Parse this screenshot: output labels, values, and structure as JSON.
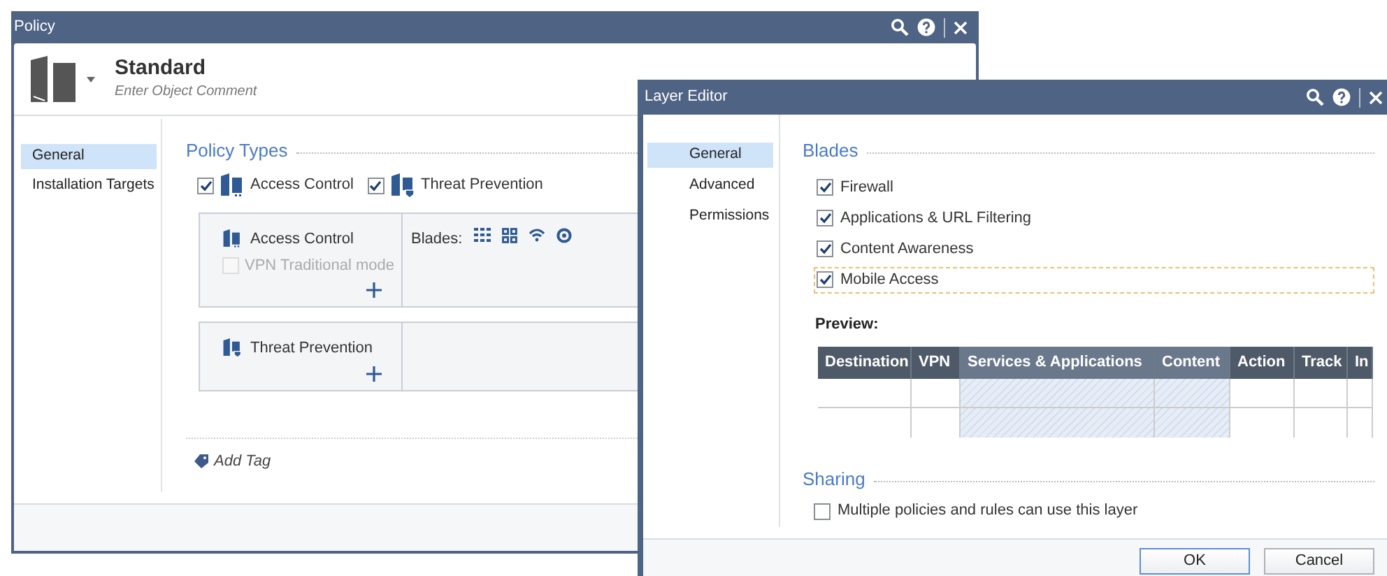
{
  "policy_window": {
    "title": "Policy",
    "header": {
      "name": "Standard",
      "comment": "Enter Object Comment"
    },
    "nav": [
      {
        "label": "General",
        "selected": true
      },
      {
        "label": "Installation Targets",
        "selected": false
      }
    ],
    "policy_types": {
      "title": "Policy Types",
      "options": [
        {
          "label": "Access Control",
          "checked": true
        },
        {
          "label": "Threat Prevention",
          "checked": true
        }
      ]
    },
    "cards": [
      {
        "title": "Access Control",
        "option": {
          "label": "VPN Traditional mode",
          "checked": false,
          "disabled": true
        },
        "blades_label": "Blades:"
      },
      {
        "title": "Threat Prevention"
      }
    ],
    "add_tag": "Add Tag"
  },
  "layer_editor": {
    "title": "Layer Editor",
    "nav": [
      {
        "label": "General",
        "selected": true
      },
      {
        "label": "Advanced",
        "selected": false
      },
      {
        "label": "Permissions",
        "selected": false
      }
    ],
    "blades": {
      "title": "Blades",
      "items": [
        {
          "label": "Firewall",
          "checked": true,
          "focused": false
        },
        {
          "label": "Applications & URL Filtering",
          "checked": true,
          "focused": false
        },
        {
          "label": "Content Awareness",
          "checked": true,
          "focused": false
        },
        {
          "label": "Mobile Access",
          "checked": true,
          "focused": true
        }
      ]
    },
    "preview": {
      "title": "Preview:",
      "columns": [
        {
          "label": "Destination",
          "highlighted": false
        },
        {
          "label": "VPN",
          "highlighted": false
        },
        {
          "label": "Services & Applications",
          "highlighted": true
        },
        {
          "label": "Content",
          "highlighted": true
        },
        {
          "label": "Action",
          "highlighted": false
        },
        {
          "label": "Track",
          "highlighted": false
        },
        {
          "label": "In",
          "highlighted": false
        }
      ]
    },
    "sharing": {
      "title": "Sharing",
      "option": {
        "label": "Multiple policies and rules can use this layer",
        "checked": false
      }
    },
    "buttons": [
      {
        "label": "OK",
        "default": true
      },
      {
        "label": "Cancel",
        "default": false
      }
    ]
  }
}
